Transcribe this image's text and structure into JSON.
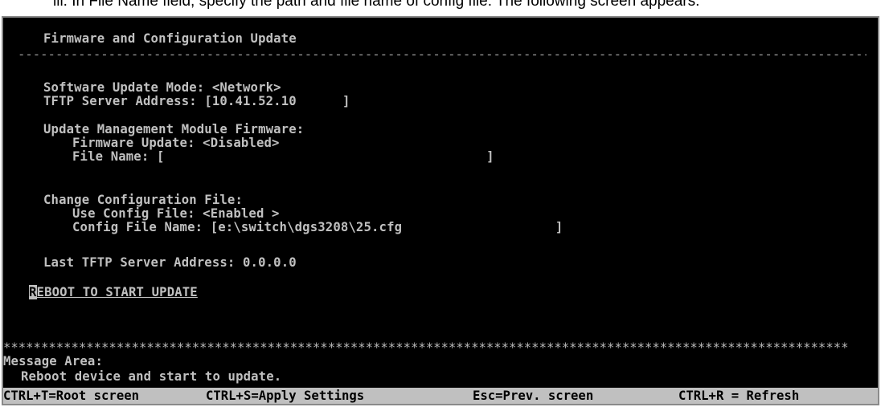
{
  "caption": "iii. In File Name field, specify the path and file name of config file. The following screen appears.",
  "screen": {
    "title": "Firmware and Configuration Update",
    "separator": "--------------------------------------------------------------------------------------------------------------------------------------------------------------------------",
    "software_update_mode_label": "Software Update Mode:",
    "software_update_mode_value": "<Network>",
    "tftp_server_label": "TFTP Server Address:",
    "tftp_server_value": "[10.41.52.10      ]",
    "update_mgmt_heading": "Update Management Module Firmware:",
    "firmware_update_label": "Firmware Update:",
    "firmware_update_value": "<Disabled>",
    "file_name_label": "File Name:",
    "file_name_value": "[                                          ]",
    "change_config_heading": "Change Configuration File:",
    "use_config_label": "Use Config File:",
    "use_config_value": "<Enabled >",
    "config_file_name_label": "Config File Name:",
    "config_file_name_value": "[e:\\switch\\dgs3208\\25.cfg                    ]",
    "last_tftp_label": "Last TFTP Server Address:",
    "last_tftp_value": "0.0.0.0",
    "reboot_cursor": "R",
    "reboot_rest": "EBOOT TO START UPDATE",
    "stars": "****************************************************************************************************************",
    "message_area_label": "Message Area:",
    "message_text": "Reboot device and start to update."
  },
  "statusbar": {
    "root": "CTRL+T=Root screen",
    "apply": "CTRL+S=Apply Settings",
    "prev": "Esc=Prev. screen",
    "refresh": "CTRL+R = Refresh"
  }
}
